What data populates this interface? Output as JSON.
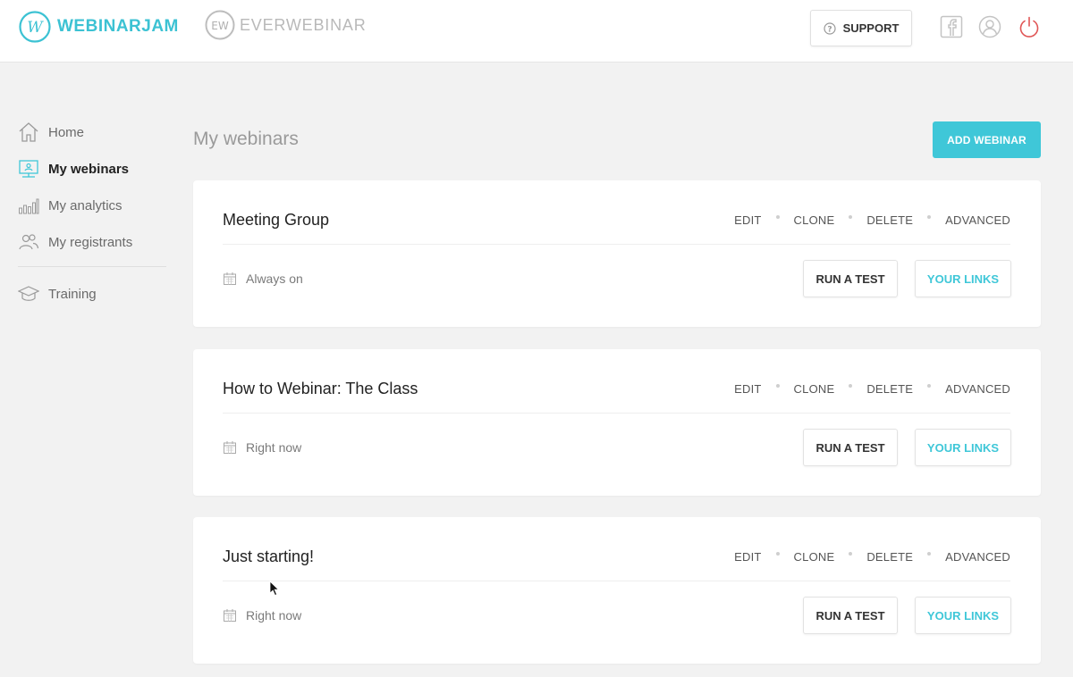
{
  "header": {
    "brand_primary": "WEBINARJAM",
    "brand_primary_logo": "W",
    "brand_secondary": "EVERWEBINAR",
    "brand_secondary_logo": "EW",
    "support_label": "SUPPORT",
    "icons": [
      "question-icon",
      "facebook-icon",
      "user-icon",
      "power-icon"
    ]
  },
  "colors": {
    "accent": "#3fc7d8",
    "power": "#e05555",
    "background": "#f2f2f2"
  },
  "sidebar": {
    "items": [
      {
        "label": "Home",
        "icon": "home-icon"
      },
      {
        "label": "My webinars",
        "icon": "monitor-icon",
        "active": true
      },
      {
        "label": "My analytics",
        "icon": "bar-chart-icon"
      },
      {
        "label": "My registrants",
        "icon": "users-icon"
      },
      {
        "label": "Training",
        "icon": "graduation-cap-icon"
      }
    ]
  },
  "main": {
    "title": "My webinars",
    "add_button": "ADD WEBINAR",
    "webinars": [
      {
        "title": "Meeting Group",
        "schedule": "Always on"
      },
      {
        "title": "How to Webinar: The Class",
        "schedule": "Right now"
      },
      {
        "title": "Just starting!",
        "schedule": "Right now"
      }
    ],
    "actions": {
      "edit": "EDIT",
      "clone": "CLONE",
      "delete": "DELETE",
      "advanced": "ADVANCED",
      "run_test": "RUN A TEST",
      "your_links": "YOUR LINKS"
    }
  }
}
